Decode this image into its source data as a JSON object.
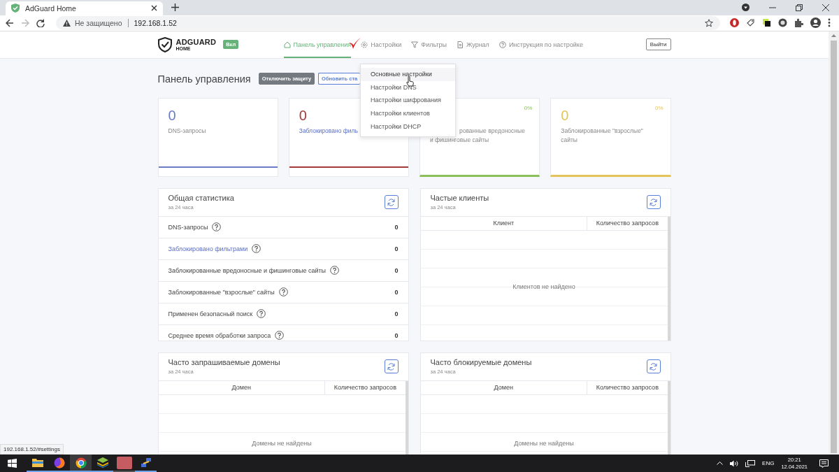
{
  "browser": {
    "tab_title": "AdGuard Home",
    "security": "Не защищено",
    "url": "192.168.1.52"
  },
  "header": {
    "logo": "ADGUARD",
    "logo_sub": "HOME",
    "status_badge": "Вкл",
    "logout": "Выйти",
    "nav": [
      {
        "label": "Панель управления",
        "kind": "home",
        "selected": true
      },
      {
        "label": "Настройки",
        "kind": "gear",
        "selected": false
      },
      {
        "label": "Фильтры",
        "kind": "filter",
        "selected": false
      },
      {
        "label": "Журнал",
        "kind": "doc",
        "selected": false
      },
      {
        "label": "Инструкция по настройке",
        "kind": "help",
        "selected": false
      }
    ]
  },
  "dashboard": {
    "title": "Панель управления",
    "buttons": [
      {
        "label": "Отключить защиту",
        "kind": "solid"
      },
      {
        "label": "Обновить ста",
        "kind": "outline"
      }
    ]
  },
  "cards": [
    {
      "value": "0",
      "label": "DNS-запросы",
      "color": "#6b7bc4",
      "link": false
    },
    {
      "value": "0",
      "label": "Заблокировано филь",
      "color": "#a33a3a",
      "link": true
    },
    {
      "percent": "0%",
      "label": "рованные вредоносные и фишинговые сайты",
      "color": "#8bbf5a",
      "link": false
    },
    {
      "value": "0",
      "percent": "0%",
      "label": "Заблокированные \"взрослые\" сайты",
      "color": "#e3c45a",
      "link": false
    }
  ],
  "general_stats": {
    "title": "Общая статистика",
    "subtitle": "за 24 часа",
    "rows": [
      {
        "label": "DNS-запросы",
        "value": "0",
        "link": false
      },
      {
        "label": "Заблокировано фильтрами",
        "value": "0",
        "link": true
      },
      {
        "label": "Заблокированные вредоносные и фишинговые сайты",
        "value": "0",
        "link": false
      },
      {
        "label": "Заблокированные \"взрослые\" сайты",
        "value": "0",
        "link": false
      },
      {
        "label": "Применен безопасный поиск",
        "value": "0",
        "link": false
      },
      {
        "label": "Среднее время обработки запроса",
        "value": "0",
        "link": false
      }
    ]
  },
  "top_clients": {
    "title": "Частые клиенты",
    "subtitle": "за 24 часа",
    "columns": [
      "Клиент",
      "Количество запросов"
    ],
    "empty": "Клиентов не найдено"
  },
  "top_queried": {
    "title": "Часто запрашиваемые домены",
    "subtitle": "за 24 часа",
    "columns": [
      "Домен",
      "Количество запросов"
    ],
    "empty": "Домены не найдены"
  },
  "top_blocked": {
    "title": "Часто блокируемые домены",
    "subtitle": "за 24 часа",
    "columns": [
      "Домен",
      "Количество запросов"
    ],
    "empty": "Домены не найдены"
  },
  "settings_menu": {
    "items": [
      {
        "label": "Основные настройки",
        "hovered": true
      },
      {
        "label": "Настройки DNS",
        "hovered": false
      },
      {
        "label": "Настройки шифрования",
        "hovered": false
      },
      {
        "label": "Настройки клиентов",
        "hovered": false
      },
      {
        "label": "Настройки DHCP",
        "hovered": false
      }
    ]
  },
  "status_link": "192.168.1.52/#settings",
  "taskbar": {
    "language": "ENG",
    "time": "20:21",
    "date": "12.04.2021"
  }
}
